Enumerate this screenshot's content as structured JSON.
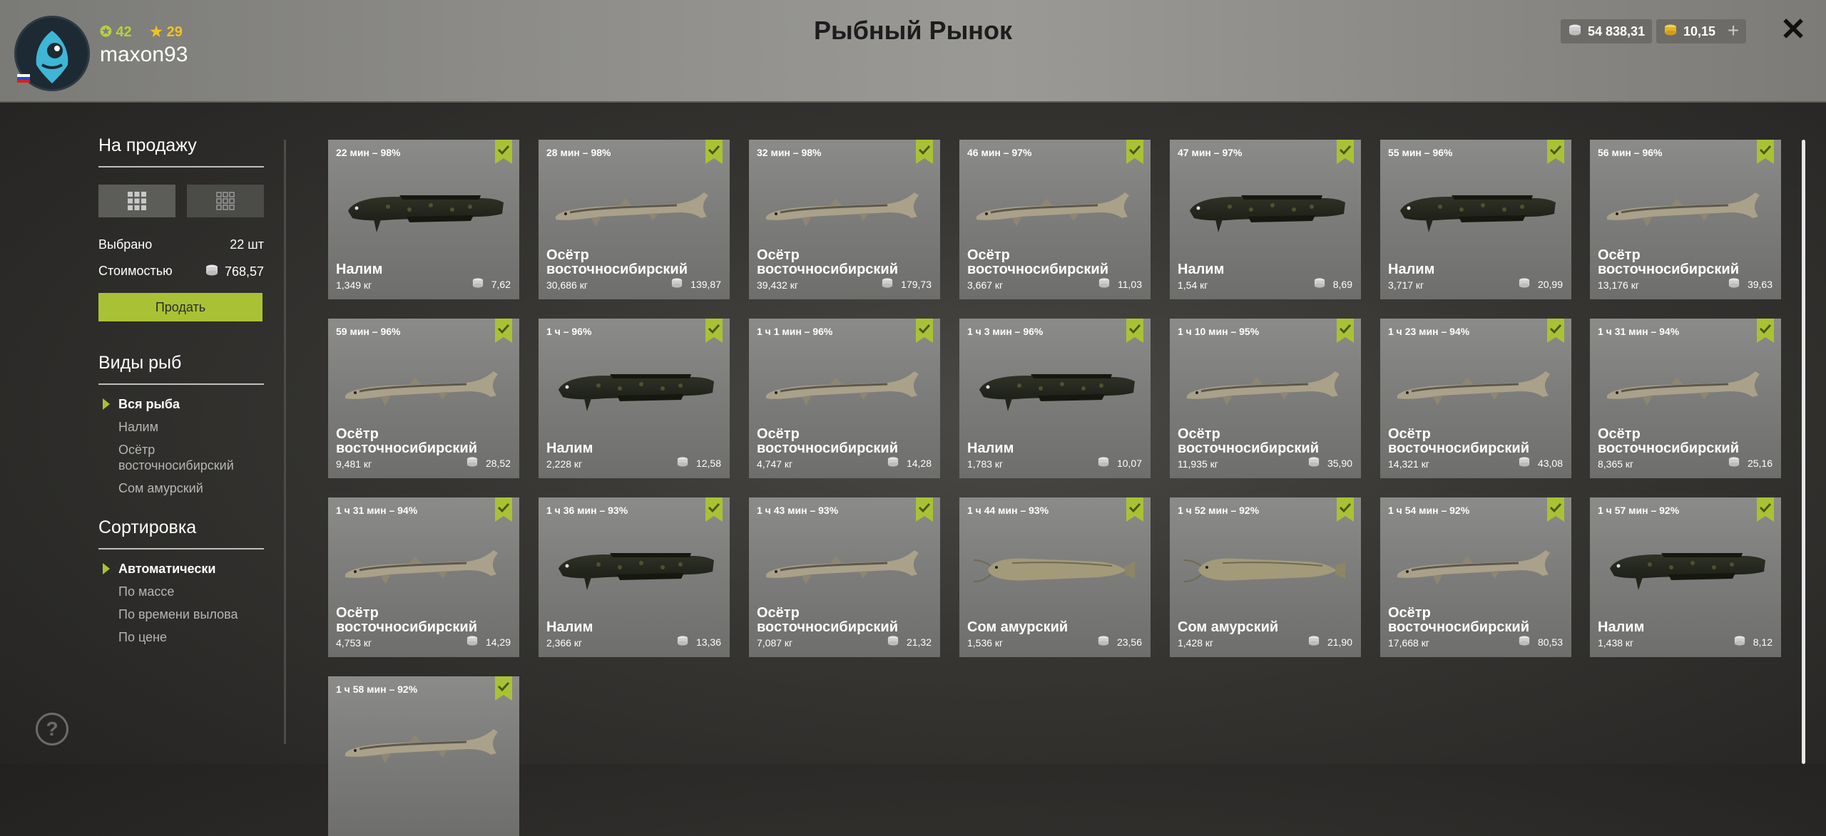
{
  "header": {
    "title": "Рыбный Рынок",
    "level": "42",
    "rank": "29",
    "username": "maxon93",
    "silver": "54 838,31",
    "gold": "10,15",
    "plus_icon": "plus-icon",
    "close_icon": "close-icon"
  },
  "sidebar": {
    "for_sale_title": "На продажу",
    "selected_label": "Выбрано",
    "selected_value": "22 шт",
    "cost_label": "Стоимостью",
    "cost_value": "768,57",
    "sell_button": "Продать",
    "species_title": "Виды рыб",
    "species": [
      "Вся рыба",
      "Налим",
      "Осётр восточносибирский",
      "Сом амурский"
    ],
    "sort_title": "Сортировка",
    "sort": [
      "Автоматически",
      "По массе",
      "По времени вылова",
      "По цене"
    ]
  },
  "colors": {
    "accent": "#a9c235",
    "rank": "#f0c323",
    "header_bg": "#8e8d89",
    "card_bg": "#7d7d7b"
  },
  "cards": [
    {
      "time": "22 мин – 98%",
      "name": "Налим",
      "weight": "1,349 кг",
      "price": "7,62",
      "fish": "burbot"
    },
    {
      "time": "28 мин – 98%",
      "name": "Осётр восточносибирский",
      "weight": "30,686 кг",
      "price": "139,87",
      "fish": "sturgeon"
    },
    {
      "time": "32 мин – 98%",
      "name": "Осётр восточносибирский",
      "weight": "39,432 кг",
      "price": "179,73",
      "fish": "sturgeon"
    },
    {
      "time": "46 мин – 97%",
      "name": "Осётр восточносибирский",
      "weight": "3,667 кг",
      "price": "11,03",
      "fish": "sturgeon"
    },
    {
      "time": "47 мин – 97%",
      "name": "Налим",
      "weight": "1,54 кг",
      "price": "8,69",
      "fish": "burbot"
    },
    {
      "time": "55 мин – 96%",
      "name": "Налим",
      "weight": "3,717 кг",
      "price": "20,99",
      "fish": "burbot"
    },
    {
      "time": "56 мин – 96%",
      "name": "Осётр восточносибирский",
      "weight": "13,176 кг",
      "price": "39,63",
      "fish": "sturgeon"
    },
    {
      "time": "59 мин – 96%",
      "name": "Осётр восточносибирский",
      "weight": "9,481 кг",
      "price": "28,52",
      "fish": "sturgeon"
    },
    {
      "time": "1 ч – 96%",
      "name": "Налим",
      "weight": "2,228 кг",
      "price": "12,58",
      "fish": "burbot"
    },
    {
      "time": "1 ч 1 мин – 96%",
      "name": "Осётр восточносибирский",
      "weight": "4,747 кг",
      "price": "14,28",
      "fish": "sturgeon"
    },
    {
      "time": "1 ч 3 мин – 96%",
      "name": "Налим",
      "weight": "1,783 кг",
      "price": "10,07",
      "fish": "burbot"
    },
    {
      "time": "1 ч 10 мин – 95%",
      "name": "Осётр восточносибирский",
      "weight": "11,935 кг",
      "price": "35,90",
      "fish": "sturgeon"
    },
    {
      "time": "1 ч 23 мин – 94%",
      "name": "Осётр восточносибирский",
      "weight": "14,321 кг",
      "price": "43,08",
      "fish": "sturgeon"
    },
    {
      "time": "1 ч 31 мин – 94%",
      "name": "Осётр восточносибирский",
      "weight": "8,365 кг",
      "price": "25,16",
      "fish": "sturgeon"
    },
    {
      "time": "1 ч 31 мин – 94%",
      "name": "Осётр восточносибирский",
      "weight": "4,753 кг",
      "price": "14,29",
      "fish": "sturgeon"
    },
    {
      "time": "1 ч 36 мин – 93%",
      "name": "Налим",
      "weight": "2,366 кг",
      "price": "13,36",
      "fish": "burbot"
    },
    {
      "time": "1 ч 43 мин – 93%",
      "name": "Осётр восточносибирский",
      "weight": "7,087 кг",
      "price": "21,32",
      "fish": "sturgeon"
    },
    {
      "time": "1 ч 44 мин – 93%",
      "name": "Сом амурский",
      "weight": "1,536 кг",
      "price": "23,56",
      "fish": "catfish"
    },
    {
      "time": "1 ч 52 мин – 92%",
      "name": "Сом амурский",
      "weight": "1,428 кг",
      "price": "21,90",
      "fish": "catfish"
    },
    {
      "time": "1 ч 54 мин – 92%",
      "name": "Осётр восточносибирский",
      "weight": "17,668 кг",
      "price": "80,53",
      "fish": "sturgeon"
    },
    {
      "time": "1 ч 57 мин – 92%",
      "name": "Налим",
      "weight": "1,438 кг",
      "price": "8,12",
      "fish": "burbot"
    },
    {
      "time": "1 ч 58 мин – 92%",
      "name": "",
      "weight": "",
      "price": "",
      "fish": "sturgeon"
    }
  ]
}
